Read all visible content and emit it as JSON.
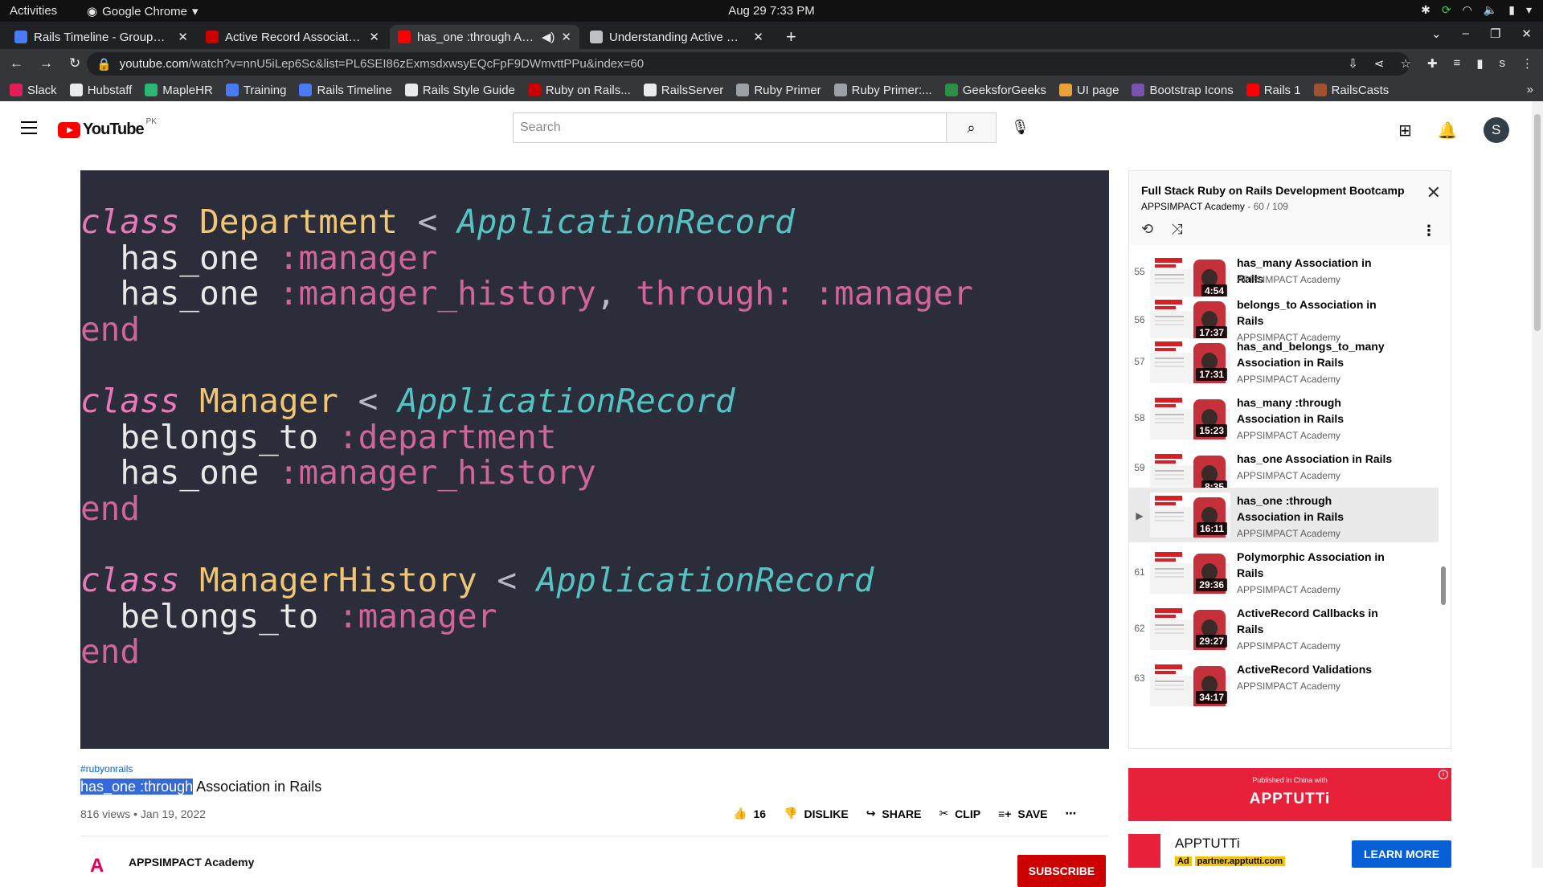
{
  "os": {
    "activities": "Activities",
    "app_name": "Google Chrome",
    "clock": "Aug 29  7:33 PM"
  },
  "tabs": [
    {
      "title": "Rails Timeline - Grouped -",
      "icon": "docs-icon",
      "color": "#4a7bf7"
    },
    {
      "title": "Active Record Association",
      "icon": "rails-icon",
      "color": "#cc0000"
    },
    {
      "title": "has_one :through Asso",
      "icon": "youtube-icon",
      "color": "#ff0000"
    },
    {
      "title": "Understanding Active Rec",
      "icon": "page-icon",
      "color": "#bdc1c6"
    }
  ],
  "url": {
    "domain": "youtube.com",
    "path": "/watch?v=nnU5iLep6Sc&list=PL6SEI86zExmsdxwsyEQcFpF9DWmvttPPu&index=60"
  },
  "bookmarks": [
    {
      "label": "Slack",
      "color": "#e01e5a"
    },
    {
      "label": "Hubstaff",
      "color": "#e8eaed"
    },
    {
      "label": "MapleHR",
      "color": "#2bb673"
    },
    {
      "label": "Training",
      "color": "#4a7bf7"
    },
    {
      "label": "Rails Timeline",
      "color": "#4a7bf7"
    },
    {
      "label": "Rails Style Guide",
      "color": "#e8eaed"
    },
    {
      "label": "Ruby on Rails...",
      "color": "#cc0000"
    },
    {
      "label": "RailsServer",
      "color": "#e8eaed"
    },
    {
      "label": "Ruby Primer",
      "color": "#9aa0a6"
    },
    {
      "label": "Ruby Primer:...",
      "color": "#9aa0a6"
    },
    {
      "label": "GeeksforGeeks",
      "color": "#2f8d46"
    },
    {
      "label": "UI page",
      "color": "#e8a13a"
    },
    {
      "label": "Bootstrap Icons",
      "color": "#7952b3"
    },
    {
      "label": "Rails 1",
      "color": "#ff0000"
    },
    {
      "label": "RailsCasts",
      "color": "#a0522d"
    }
  ],
  "youtube": {
    "logo_text": "YouTube",
    "country": "PK",
    "search_placeholder": "Search",
    "avatar_letter": "S"
  },
  "video": {
    "code_lines": [
      [
        {
          "c": "kw",
          "t": "class "
        },
        {
          "c": "cn",
          "t": "Department"
        },
        {
          "c": "op",
          "t": " < "
        },
        {
          "c": "bs",
          "t": "ApplicationRecord"
        }
      ],
      [
        {
          "c": "",
          "t": "  has_one "
        },
        {
          "c": "sym",
          "t": ":manager"
        }
      ],
      [
        {
          "c": "",
          "t": "  has_one "
        },
        {
          "c": "sym",
          "t": ":manager_history"
        },
        {
          "c": "op",
          "t": ", "
        },
        {
          "c": "sym",
          "t": "through: :manager"
        }
      ],
      [
        {
          "c": "end",
          "t": "end"
        }
      ],
      [
        {
          "c": "",
          "t": ""
        }
      ],
      [
        {
          "c": "kw",
          "t": "class "
        },
        {
          "c": "cn",
          "t": "Manager"
        },
        {
          "c": "op",
          "t": " < "
        },
        {
          "c": "bs",
          "t": "ApplicationRecord"
        }
      ],
      [
        {
          "c": "",
          "t": "  belongs_to "
        },
        {
          "c": "sym",
          "t": ":department"
        }
      ],
      [
        {
          "c": "",
          "t": "  has_one "
        },
        {
          "c": "sym",
          "t": ":manager_history"
        }
      ],
      [
        {
          "c": "end",
          "t": "end"
        }
      ],
      [
        {
          "c": "",
          "t": ""
        }
      ],
      [
        {
          "c": "kw",
          "t": "class "
        },
        {
          "c": "cn",
          "t": "ManagerHistory"
        },
        {
          "c": "op",
          "t": " < "
        },
        {
          "c": "bs",
          "t": "ApplicationRecord"
        }
      ],
      [
        {
          "c": "",
          "t": "  belongs_to "
        },
        {
          "c": "sym",
          "t": ":manager"
        }
      ],
      [
        {
          "c": "end",
          "t": "end"
        }
      ]
    ],
    "hashtag": "#rubyonrails",
    "title_highlight": "has_one :through",
    "title_rest": " Association in Rails",
    "views_date": "816 views • Jan 19, 2022",
    "likes": "16",
    "dislike": "DISLIKE",
    "share": "SHARE",
    "clip": "CLIP",
    "save": "SAVE",
    "channel": "APPSIMPACT Academy",
    "subscribe": "SUBSCRIBE"
  },
  "playlist": {
    "title": "Full Stack Ruby on Rails Development Bootcamp",
    "owner": "APPSIMPACT Academy",
    "progress": "- 60 / 109",
    "items": [
      {
        "idx": "55",
        "title": "has_many Association in Rails",
        "author": "APPSIMPACT Academy",
        "duration": "4:54",
        "current": false
      },
      {
        "idx": "56",
        "title": "belongs_to Association in Rails",
        "author": "APPSIMPACT Academy",
        "duration": "17:37",
        "current": false
      },
      {
        "idx": "57",
        "title": "has_and_belongs_to_many Association in Rails",
        "author": "APPSIMPACT Academy",
        "duration": "17:31",
        "current": false
      },
      {
        "idx": "58",
        "title": "has_many :through Association in Rails",
        "author": "APPSIMPACT Academy",
        "duration": "15:23",
        "current": false
      },
      {
        "idx": "59",
        "title": "has_one Association in Rails",
        "author": "APPSIMPACT Academy",
        "duration": "8:35",
        "current": false
      },
      {
        "idx": "▶",
        "title": "has_one :through Association in Rails",
        "author": "APPSIMPACT Academy",
        "duration": "16:11",
        "current": true
      },
      {
        "idx": "61",
        "title": "Polymorphic Association in Rails",
        "author": "APPSIMPACT Academy",
        "duration": "29:36",
        "current": false
      },
      {
        "idx": "62",
        "title": "ActiveRecord Callbacks in Rails",
        "author": "APPSIMPACT Academy",
        "duration": "29:27",
        "current": false
      },
      {
        "idx": "63",
        "title": "ActiveRecord Validations",
        "author": "APPSIMPACT Academy",
        "duration": "34:17",
        "current": false
      }
    ]
  },
  "ad": {
    "published": "Published in China with",
    "brand": "APPTUTTi",
    "advertiser": "APPTUTTi",
    "ad_badge": "Ad",
    "domain": "partner.apptutti.com",
    "cta": "LEARN MORE"
  }
}
